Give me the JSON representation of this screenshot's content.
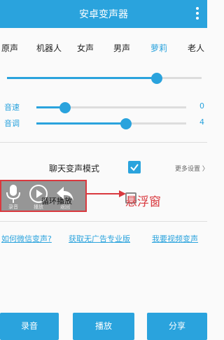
{
  "app": {
    "title": "安卓变声器"
  },
  "tabs": [
    "原声",
    "机器人",
    "女声",
    "男声",
    "萝莉",
    "老人"
  ],
  "active_tab": "萝莉",
  "main_slider": {
    "value_fraction": 0.77
  },
  "speed": {
    "label": "音速",
    "value": "0",
    "fraction": 0.19
  },
  "pitch": {
    "label": "音调",
    "value": "4",
    "fraction": 0.6
  },
  "chat_mode": {
    "label": "聊天变声模式",
    "checked": true
  },
  "more_settings": "更多设置 〉",
  "loop_play": {
    "label": "循环播放",
    "checked": false
  },
  "floating_window": {
    "items": [
      {
        "icon": "microphone-icon",
        "label": "录音"
      },
      {
        "icon": "play-icon",
        "label": "播放"
      },
      {
        "icon": "back-icon",
        "label": "返回"
      }
    ]
  },
  "annotation": {
    "text": "悬浮窗",
    "color": "#d9393f"
  },
  "links": [
    "如何微信变声?",
    "获取无广告专业版",
    "我要视频变声"
  ],
  "buttons": {
    "record": "录音",
    "play": "播放",
    "share": "分享"
  },
  "colors": {
    "accent": "#2aa3dd",
    "annotation": "#d9393f"
  }
}
